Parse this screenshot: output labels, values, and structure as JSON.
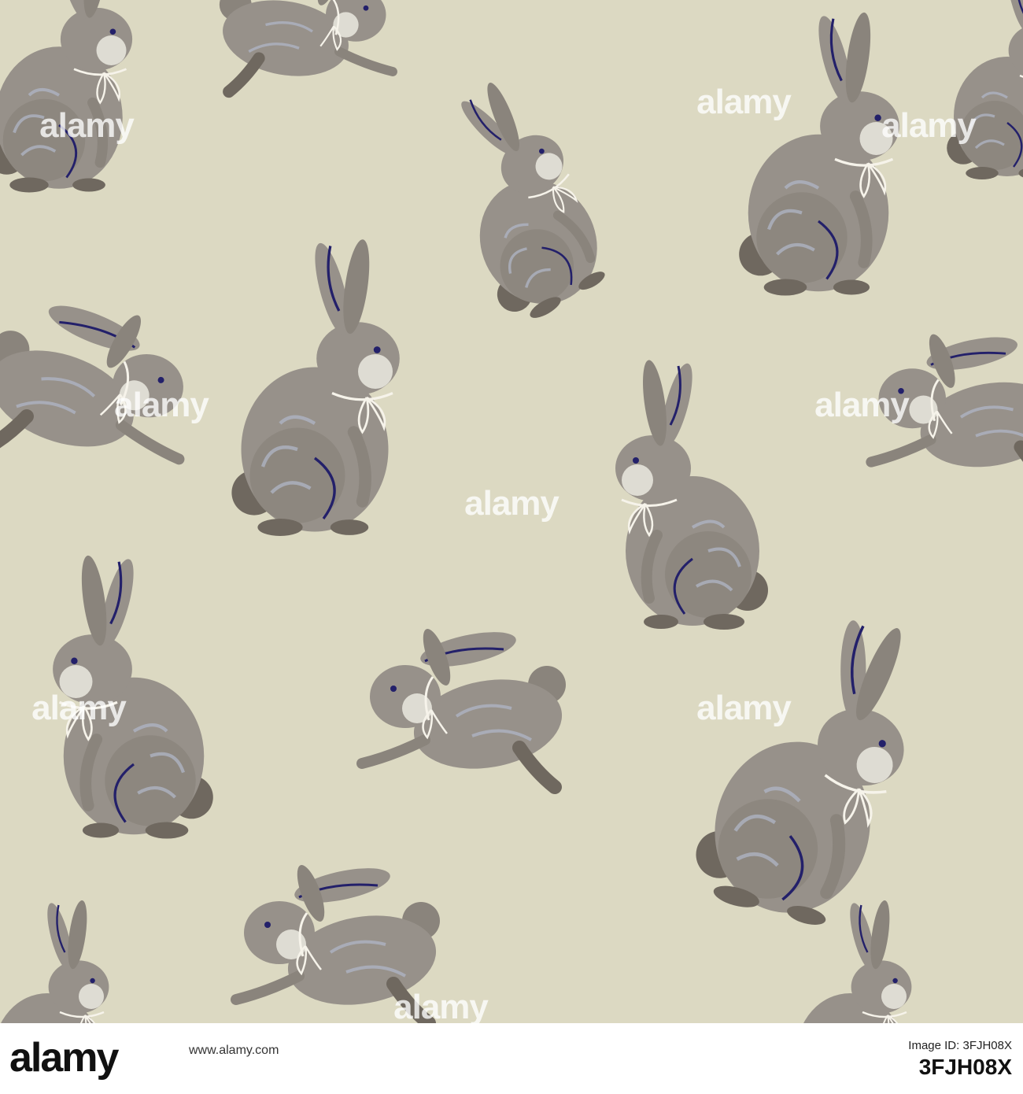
{
  "colors": {
    "background": "#dcd9c2",
    "bunny": "#97918a",
    "bunny_shadow": "#6f685f",
    "bunny_highlight": "#aeb3c2",
    "muzzle": "#dedcd3",
    "ribbon": "#f6f3ea",
    "accent_navy": "#23206a"
  },
  "watermark": {
    "text": "alamy"
  },
  "footer": {
    "logo": "alamy",
    "meta": "www.alamy.com",
    "image_id_label": "Image ID: 3FJH08X",
    "image_id": "3FJH08X"
  }
}
